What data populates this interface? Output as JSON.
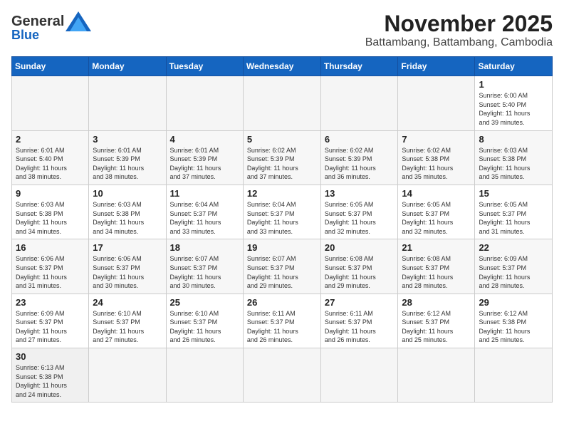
{
  "header": {
    "logo_general": "General",
    "logo_blue": "Blue",
    "month_year": "November 2025",
    "location": "Battambang, Battambang, Cambodia"
  },
  "days_of_week": [
    "Sunday",
    "Monday",
    "Tuesday",
    "Wednesday",
    "Thursday",
    "Friday",
    "Saturday"
  ],
  "weeks": [
    [
      {
        "day": "",
        "info": ""
      },
      {
        "day": "",
        "info": ""
      },
      {
        "day": "",
        "info": ""
      },
      {
        "day": "",
        "info": ""
      },
      {
        "day": "",
        "info": ""
      },
      {
        "day": "",
        "info": ""
      },
      {
        "day": "1",
        "info": "Sunrise: 6:00 AM\nSunset: 5:40 PM\nDaylight: 11 hours\nand 39 minutes."
      }
    ],
    [
      {
        "day": "2",
        "info": "Sunrise: 6:01 AM\nSunset: 5:40 PM\nDaylight: 11 hours\nand 38 minutes."
      },
      {
        "day": "3",
        "info": "Sunrise: 6:01 AM\nSunset: 5:39 PM\nDaylight: 11 hours\nand 38 minutes."
      },
      {
        "day": "4",
        "info": "Sunrise: 6:01 AM\nSunset: 5:39 PM\nDaylight: 11 hours\nand 37 minutes."
      },
      {
        "day": "5",
        "info": "Sunrise: 6:02 AM\nSunset: 5:39 PM\nDaylight: 11 hours\nand 37 minutes."
      },
      {
        "day": "6",
        "info": "Sunrise: 6:02 AM\nSunset: 5:39 PM\nDaylight: 11 hours\nand 36 minutes."
      },
      {
        "day": "7",
        "info": "Sunrise: 6:02 AM\nSunset: 5:38 PM\nDaylight: 11 hours\nand 35 minutes."
      },
      {
        "day": "8",
        "info": "Sunrise: 6:03 AM\nSunset: 5:38 PM\nDaylight: 11 hours\nand 35 minutes."
      }
    ],
    [
      {
        "day": "9",
        "info": "Sunrise: 6:03 AM\nSunset: 5:38 PM\nDaylight: 11 hours\nand 34 minutes."
      },
      {
        "day": "10",
        "info": "Sunrise: 6:03 AM\nSunset: 5:38 PM\nDaylight: 11 hours\nand 34 minutes."
      },
      {
        "day": "11",
        "info": "Sunrise: 6:04 AM\nSunset: 5:37 PM\nDaylight: 11 hours\nand 33 minutes."
      },
      {
        "day": "12",
        "info": "Sunrise: 6:04 AM\nSunset: 5:37 PM\nDaylight: 11 hours\nand 33 minutes."
      },
      {
        "day": "13",
        "info": "Sunrise: 6:05 AM\nSunset: 5:37 PM\nDaylight: 11 hours\nand 32 minutes."
      },
      {
        "day": "14",
        "info": "Sunrise: 6:05 AM\nSunset: 5:37 PM\nDaylight: 11 hours\nand 32 minutes."
      },
      {
        "day": "15",
        "info": "Sunrise: 6:05 AM\nSunset: 5:37 PM\nDaylight: 11 hours\nand 31 minutes."
      }
    ],
    [
      {
        "day": "16",
        "info": "Sunrise: 6:06 AM\nSunset: 5:37 PM\nDaylight: 11 hours\nand 31 minutes."
      },
      {
        "day": "17",
        "info": "Sunrise: 6:06 AM\nSunset: 5:37 PM\nDaylight: 11 hours\nand 30 minutes."
      },
      {
        "day": "18",
        "info": "Sunrise: 6:07 AM\nSunset: 5:37 PM\nDaylight: 11 hours\nand 30 minutes."
      },
      {
        "day": "19",
        "info": "Sunrise: 6:07 AM\nSunset: 5:37 PM\nDaylight: 11 hours\nand 29 minutes."
      },
      {
        "day": "20",
        "info": "Sunrise: 6:08 AM\nSunset: 5:37 PM\nDaylight: 11 hours\nand 29 minutes."
      },
      {
        "day": "21",
        "info": "Sunrise: 6:08 AM\nSunset: 5:37 PM\nDaylight: 11 hours\nand 28 minutes."
      },
      {
        "day": "22",
        "info": "Sunrise: 6:09 AM\nSunset: 5:37 PM\nDaylight: 11 hours\nand 28 minutes."
      }
    ],
    [
      {
        "day": "23",
        "info": "Sunrise: 6:09 AM\nSunset: 5:37 PM\nDaylight: 11 hours\nand 27 minutes."
      },
      {
        "day": "24",
        "info": "Sunrise: 6:10 AM\nSunset: 5:37 PM\nDaylight: 11 hours\nand 27 minutes."
      },
      {
        "day": "25",
        "info": "Sunrise: 6:10 AM\nSunset: 5:37 PM\nDaylight: 11 hours\nand 26 minutes."
      },
      {
        "day": "26",
        "info": "Sunrise: 6:11 AM\nSunset: 5:37 PM\nDaylight: 11 hours\nand 26 minutes."
      },
      {
        "day": "27",
        "info": "Sunrise: 6:11 AM\nSunset: 5:37 PM\nDaylight: 11 hours\nand 26 minutes."
      },
      {
        "day": "28",
        "info": "Sunrise: 6:12 AM\nSunset: 5:37 PM\nDaylight: 11 hours\nand 25 minutes."
      },
      {
        "day": "29",
        "info": "Sunrise: 6:12 AM\nSunset: 5:38 PM\nDaylight: 11 hours\nand 25 minutes."
      }
    ],
    [
      {
        "day": "30",
        "info": "Sunrise: 6:13 AM\nSunset: 5:38 PM\nDaylight: 11 hours\nand 24 minutes."
      },
      {
        "day": "",
        "info": ""
      },
      {
        "day": "",
        "info": ""
      },
      {
        "day": "",
        "info": ""
      },
      {
        "day": "",
        "info": ""
      },
      {
        "day": "",
        "info": ""
      },
      {
        "day": "",
        "info": ""
      }
    ]
  ]
}
